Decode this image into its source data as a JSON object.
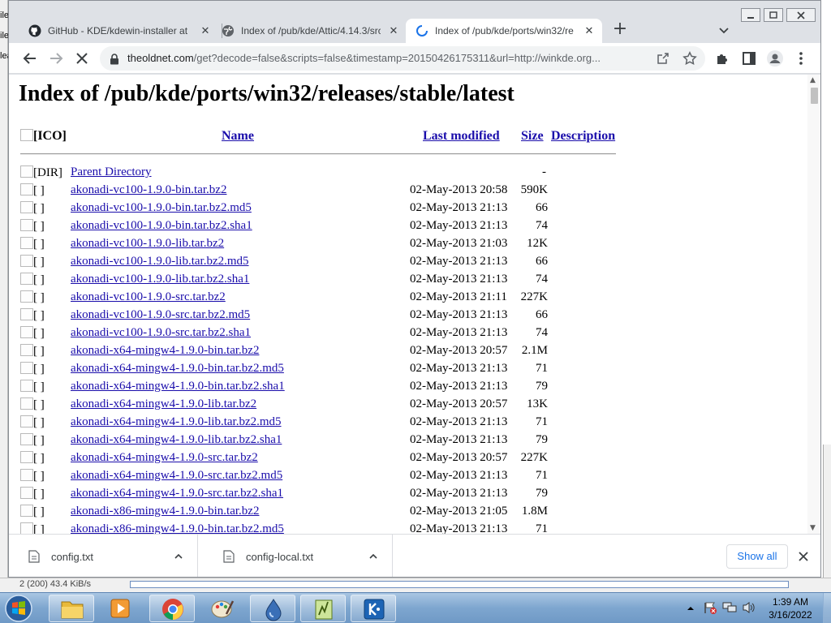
{
  "background": {
    "left_labels": [
      "ile",
      "ile",
      "lea"
    ],
    "status_text": "2 (200)  43.4 KiB/s"
  },
  "browser": {
    "tabs": [
      {
        "title": "GitHub - KDE/kdewin-installer at",
        "icon": "github-icon",
        "active": false
      },
      {
        "title": "Index of /pub/kde/Attic/4.14.3/src",
        "icon": "globe-icon",
        "active": false
      },
      {
        "title": "Index of /pub/kde/ports/win32/re",
        "icon": "loading-spinner-icon",
        "active": true
      }
    ],
    "url_host": "theoldnet.com",
    "url_path": "/get?decode=false&scripts=false&timestamp=20150426175311&url=http://winkde.org..."
  },
  "page": {
    "title": "Index of /pub/kde/ports/win32/releases/stable/latest",
    "columns": {
      "icon": "[ICO]",
      "name": "Name",
      "modified": "Last modified",
      "size": "Size",
      "description": "Description"
    },
    "parent": {
      "icon": "[DIR]",
      "name": "Parent Directory",
      "size": "-"
    },
    "rows": [
      {
        "icon": "[ ]",
        "name": "akonadi-vc100-1.9.0-bin.tar.bz2",
        "modified": "02-May-2013 20:58",
        "size": "590K"
      },
      {
        "icon": "[ ]",
        "name": "akonadi-vc100-1.9.0-bin.tar.bz2.md5",
        "modified": "02-May-2013 21:13",
        "size": "66"
      },
      {
        "icon": "[ ]",
        "name": "akonadi-vc100-1.9.0-bin.tar.bz2.sha1",
        "modified": "02-May-2013 21:13",
        "size": "74"
      },
      {
        "icon": "[ ]",
        "name": "akonadi-vc100-1.9.0-lib.tar.bz2",
        "modified": "02-May-2013 21:03",
        "size": "12K"
      },
      {
        "icon": "[ ]",
        "name": "akonadi-vc100-1.9.0-lib.tar.bz2.md5",
        "modified": "02-May-2013 21:13",
        "size": "66"
      },
      {
        "icon": "[ ]",
        "name": "akonadi-vc100-1.9.0-lib.tar.bz2.sha1",
        "modified": "02-May-2013 21:13",
        "size": "74"
      },
      {
        "icon": "[ ]",
        "name": "akonadi-vc100-1.9.0-src.tar.bz2",
        "modified": "02-May-2013 21:11",
        "size": "227K"
      },
      {
        "icon": "[ ]",
        "name": "akonadi-vc100-1.9.0-src.tar.bz2.md5",
        "modified": "02-May-2013 21:13",
        "size": "66"
      },
      {
        "icon": "[ ]",
        "name": "akonadi-vc100-1.9.0-src.tar.bz2.sha1",
        "modified": "02-May-2013 21:13",
        "size": "74"
      },
      {
        "icon": "[ ]",
        "name": "akonadi-x64-mingw4-1.9.0-bin.tar.bz2",
        "modified": "02-May-2013 20:57",
        "size": "2.1M"
      },
      {
        "icon": "[ ]",
        "name": "akonadi-x64-mingw4-1.9.0-bin.tar.bz2.md5",
        "modified": "02-May-2013 21:13",
        "size": "71"
      },
      {
        "icon": "[ ]",
        "name": "akonadi-x64-mingw4-1.9.0-bin.tar.bz2.sha1",
        "modified": "02-May-2013 21:13",
        "size": "79"
      },
      {
        "icon": "[ ]",
        "name": "akonadi-x64-mingw4-1.9.0-lib.tar.bz2",
        "modified": "02-May-2013 20:57",
        "size": "13K"
      },
      {
        "icon": "[ ]",
        "name": "akonadi-x64-mingw4-1.9.0-lib.tar.bz2.md5",
        "modified": "02-May-2013 21:13",
        "size": "71"
      },
      {
        "icon": "[ ]",
        "name": "akonadi-x64-mingw4-1.9.0-lib.tar.bz2.sha1",
        "modified": "02-May-2013 21:13",
        "size": "79"
      },
      {
        "icon": "[ ]",
        "name": "akonadi-x64-mingw4-1.9.0-src.tar.bz2",
        "modified": "02-May-2013 20:57",
        "size": "227K"
      },
      {
        "icon": "[ ]",
        "name": "akonadi-x64-mingw4-1.9.0-src.tar.bz2.md5",
        "modified": "02-May-2013 21:13",
        "size": "71"
      },
      {
        "icon": "[ ]",
        "name": "akonadi-x64-mingw4-1.9.0-src.tar.bz2.sha1",
        "modified": "02-May-2013 21:13",
        "size": "79"
      },
      {
        "icon": "[ ]",
        "name": "akonadi-x86-mingw4-1.9.0-bin.tar.bz2",
        "modified": "02-May-2013 21:05",
        "size": "1.8M"
      },
      {
        "icon": "[ ]",
        "name": "akonadi-x86-mingw4-1.9.0-bin.tar.bz2.md5",
        "modified": "02-May-2013 21:13",
        "size": "71"
      }
    ]
  },
  "downloads": {
    "items": [
      {
        "name": "config.txt"
      },
      {
        "name": "config-local.txt"
      }
    ],
    "show_all": "Show all"
  },
  "taskbar": {
    "apps": [
      "explorer-icon",
      "media-player-icon",
      "chrome-icon",
      "paint-icon",
      "droplet-app-icon",
      "notepad-plus-icon",
      "kde-icon"
    ],
    "time": "1:39 AM",
    "date": "3/16/2022"
  },
  "colors": {
    "link": "#1a0dab",
    "accent": "#1a73e8",
    "taskbar": "#7ea6cf"
  }
}
